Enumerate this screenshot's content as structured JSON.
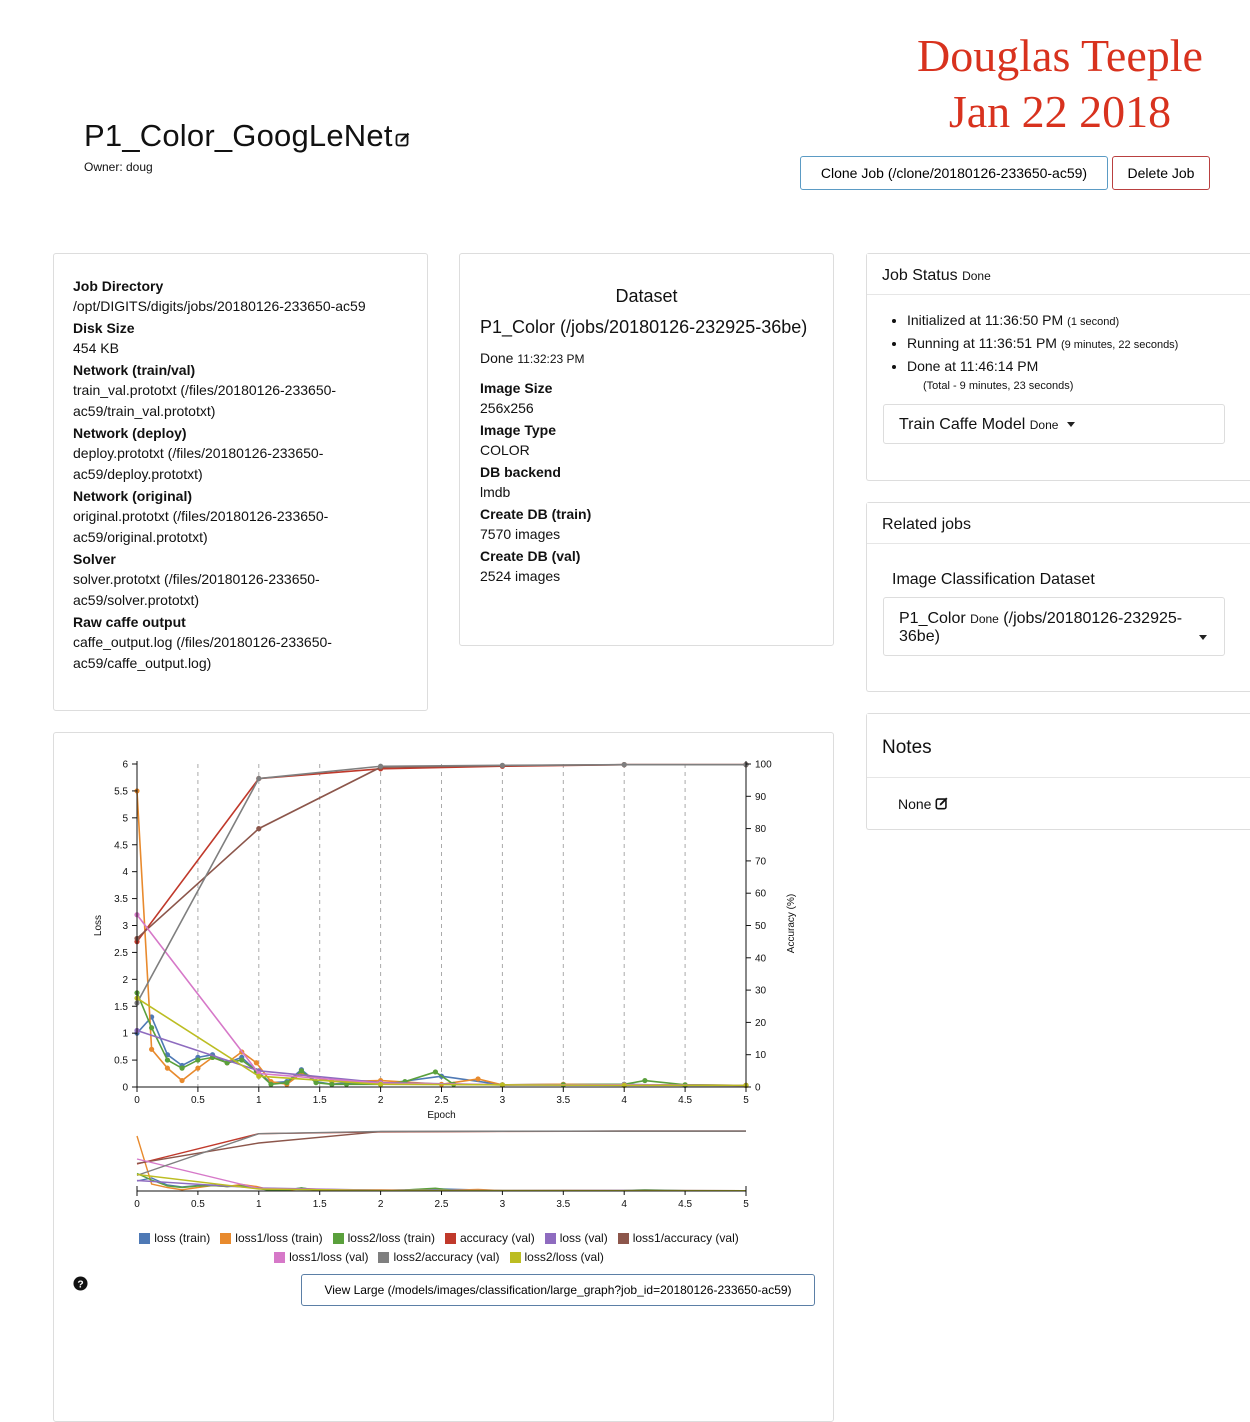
{
  "signature": {
    "line1": "Douglas Teeple",
    "line2": "Jan 22 2018"
  },
  "job": {
    "name": "P1_Color_GoogLeNet",
    "owner_label": "Owner: doug"
  },
  "buttons": {
    "clone": "Clone Job (/clone/20180126-233650-ac59)",
    "delete": "Delete Job"
  },
  "info": [
    {
      "label": "Job Directory",
      "value": "/opt/DIGITS/digits/jobs/20180126-233650-ac59"
    },
    {
      "label": "Disk Size",
      "value": "454 KB"
    },
    {
      "label": "Network (train/val)",
      "value": "train_val.prototxt (/files/20180126-233650-ac59/train_val.prototxt)"
    },
    {
      "label": "Network (deploy)",
      "value": "deploy.prototxt (/files/20180126-233650-ac59/deploy.prototxt)"
    },
    {
      "label": "Network (original)",
      "value": "original.prototxt (/files/20180126-233650-ac59/original.prototxt)"
    },
    {
      "label": "Solver",
      "value": "solver.prototxt (/files/20180126-233650-ac59/solver.prototxt)"
    },
    {
      "label": "Raw caffe output",
      "value": "caffe_output.log (/files/20180126-233650-ac59/caffe_output.log)"
    }
  ],
  "dataset": {
    "heading": "Dataset",
    "name": "P1_Color (/jobs/20180126-232925-36be)",
    "status": "Done",
    "status_time": "11:32:23 PM",
    "fields": [
      {
        "label": "Image Size",
        "value": "256x256"
      },
      {
        "label": "Image Type",
        "value": "COLOR"
      },
      {
        "label": "DB backend",
        "value": "lmdb"
      },
      {
        "label": "Create DB (train)",
        "value": "7570 images"
      },
      {
        "label": "Create DB (val)",
        "value": "2524 images"
      }
    ]
  },
  "job_status": {
    "title": "Job Status",
    "status": "Done",
    "events": [
      {
        "text": "Initialized at 11:36:50 PM",
        "note": "(1 second)"
      },
      {
        "text": "Running at 11:36:51 PM",
        "note": "(9 minutes, 22 seconds)"
      },
      {
        "text": "Done at 11:46:14 PM",
        "note": ""
      }
    ],
    "total": "(Total - 9 minutes, 23 seconds)",
    "task_label": "Train Caffe Model",
    "task_status": "Done"
  },
  "related": {
    "title": "Related jobs",
    "subtitle": "Image Classification Dataset",
    "job_name": "P1_Color",
    "job_status": "Done",
    "job_path_line1": "(/jobs/20180126-232925-",
    "job_path_line2": "36be)"
  },
  "notes": {
    "title": "Notes",
    "value": "None"
  },
  "view_large": "View Large (/models/images/classification/large_graph?job_id=20180126-233650-ac59)",
  "chart_data": {
    "type": "line",
    "xlabel": "Epoch",
    "ylabel": "Loss",
    "y2label": "Accuracy (%)",
    "xlim": [
      0,
      5
    ],
    "ylim": [
      0,
      6
    ],
    "y2lim": [
      0,
      100
    ],
    "x_ticks": [
      "0",
      "0.5",
      "1",
      "1.5",
      "2",
      "2.5",
      "3",
      "3.5",
      "4",
      "4.5",
      "5"
    ],
    "y_ticks": [
      "0",
      "0.5",
      "1",
      "1.5",
      "2",
      "2.5",
      "3",
      "3.5",
      "4",
      "4.5",
      "5",
      "5.5",
      "6"
    ],
    "y2_ticks": [
      "0",
      "10",
      "20",
      "30",
      "40",
      "50",
      "60",
      "70",
      "80",
      "90",
      "100"
    ],
    "legend_position": "bottom",
    "series": [
      {
        "name": "loss (train)",
        "axis": "loss",
        "color": "#4e79b5",
        "x": [
          0,
          0.12,
          0.25,
          0.37,
          0.5,
          0.62,
          0.74,
          0.86,
          0.98,
          1.1,
          1.23,
          1.35,
          1.47,
          1.6,
          1.72,
          2,
          2.5,
          3,
          3.5,
          4,
          4.5,
          5
        ],
        "y": [
          1.0,
          1.3,
          0.6,
          0.4,
          0.55,
          0.6,
          0.45,
          0.55,
          0.3,
          0.08,
          0.1,
          0.32,
          0.1,
          0.05,
          0.08,
          0.05,
          0.2,
          0.04,
          0.05,
          0.05,
          0.03,
          0.03
        ]
      },
      {
        "name": "loss1/loss (train)",
        "axis": "loss",
        "color": "#e88a2d",
        "x": [
          0,
          0.12,
          0.25,
          0.37,
          0.5,
          0.62,
          0.74,
          0.86,
          0.98,
          1.1,
          1.23,
          1.35,
          1.6,
          2,
          2.5,
          2.8,
          3,
          3.5,
          4,
          4.5,
          5
        ],
        "y": [
          5.5,
          0.7,
          0.35,
          0.12,
          0.35,
          0.55,
          0.45,
          0.65,
          0.45,
          0.1,
          0.05,
          0.25,
          0.1,
          0.12,
          0.05,
          0.15,
          0.04,
          0.05,
          0.04,
          0.04,
          0.03
        ]
      },
      {
        "name": "loss2/loss (train)",
        "axis": "loss",
        "color": "#5aa03c",
        "x": [
          0,
          0.12,
          0.25,
          0.37,
          0.5,
          0.62,
          0.74,
          0.86,
          0.98,
          1.1,
          1.23,
          1.35,
          1.47,
          1.6,
          1.72,
          2,
          2.2,
          2.45,
          2.6,
          3,
          3.5,
          4,
          4.17,
          4.5,
          5
        ],
        "y": [
          1.75,
          1.1,
          0.5,
          0.35,
          0.5,
          0.55,
          0.45,
          0.5,
          0.3,
          0.05,
          0.08,
          0.3,
          0.08,
          0.05,
          0.05,
          0.05,
          0.1,
          0.28,
          0.05,
          0.04,
          0.04,
          0.05,
          0.12,
          0.04,
          0.03
        ]
      },
      {
        "name": "accuracy (val)",
        "axis": "accuracy",
        "color": "#c0392b",
        "x": [
          0,
          1,
          2,
          3,
          4,
          5
        ],
        "y": [
          45,
          95.5,
          98.5,
          99.3,
          99.8,
          99.8
        ]
      },
      {
        "name": "loss (val)",
        "axis": "loss",
        "color": "#8e6bbf",
        "x": [
          0,
          1,
          2,
          3,
          4,
          5
        ],
        "y": [
          1.05,
          0.3,
          0.08,
          0.04,
          0.04,
          0.03
        ]
      },
      {
        "name": "loss1/accuracy (val)",
        "axis": "accuracy",
        "color": "#8c564b",
        "x": [
          0,
          1,
          2,
          3,
          4,
          5
        ],
        "y": [
          46,
          80,
          99,
          99.5,
          99.8,
          99.8
        ]
      },
      {
        "name": "loss1/loss (val)",
        "axis": "loss",
        "color": "#d678c8",
        "x": [
          0,
          1,
          2,
          3,
          4,
          5
        ],
        "y": [
          3.2,
          0.25,
          0.07,
          0.04,
          0.04,
          0.03
        ]
      },
      {
        "name": "loss2/accuracy (val)",
        "axis": "accuracy",
        "color": "#7f7f7f",
        "x": [
          0,
          1,
          2,
          3,
          4,
          5
        ],
        "y": [
          26,
          95.5,
          99.3,
          99.6,
          99.8,
          99.8
        ]
      },
      {
        "name": "loss2/loss (val)",
        "axis": "loss",
        "color": "#bcbd22",
        "x": [
          0,
          1,
          2,
          3,
          4,
          5
        ],
        "y": [
          1.65,
          0.2,
          0.05,
          0.04,
          0.03,
          0.03
        ]
      }
    ]
  }
}
